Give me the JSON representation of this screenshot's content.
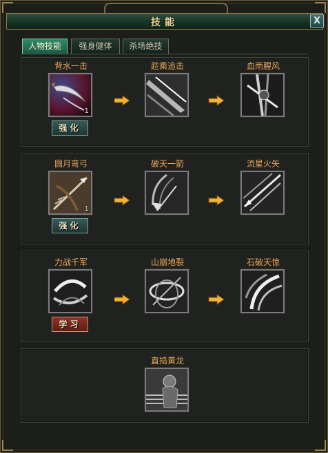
{
  "window": {
    "title": "技能",
    "close_label": "X"
  },
  "tabs": [
    {
      "label": "人物技能",
      "active": true
    },
    {
      "label": "强身健体",
      "active": false
    },
    {
      "label": "杀场绝技",
      "active": false
    }
  ],
  "rows": [
    {
      "skills": [
        {
          "name": "背水一击",
          "icon": "curved-blade-icon",
          "level": "1",
          "button": "强化"
        },
        {
          "name": "趁乘追击",
          "icon": "slash-streak-icon"
        },
        {
          "name": "血雨腥风",
          "icon": "blade-storm-icon"
        }
      ]
    },
    {
      "skills": [
        {
          "name": "圆月弯弓",
          "icon": "bow-arrow-icon",
          "level": "1",
          "button": "强化"
        },
        {
          "name": "破天一箭",
          "icon": "sky-piercing-arrow-icon"
        },
        {
          "name": "流星火矢",
          "icon": "meteor-arrows-icon"
        }
      ]
    },
    {
      "skills": [
        {
          "name": "力战千军",
          "icon": "whirlwind-slash-icon",
          "button": "学习"
        },
        {
          "name": "山崩地裂",
          "icon": "earth-split-icon"
        },
        {
          "name": "石破天惊",
          "icon": "shattering-strike-icon"
        }
      ]
    },
    {
      "skills": [
        {
          "name": "直捣黄龙",
          "icon": "dragon-charge-icon"
        }
      ]
    }
  ],
  "colors": {
    "skill_name": "#e8a45a",
    "enhance_button": "#1e3535",
    "learn_button": "#5b1d15",
    "active_tab": "#2f8a68",
    "arrow": "#f0b23a"
  }
}
